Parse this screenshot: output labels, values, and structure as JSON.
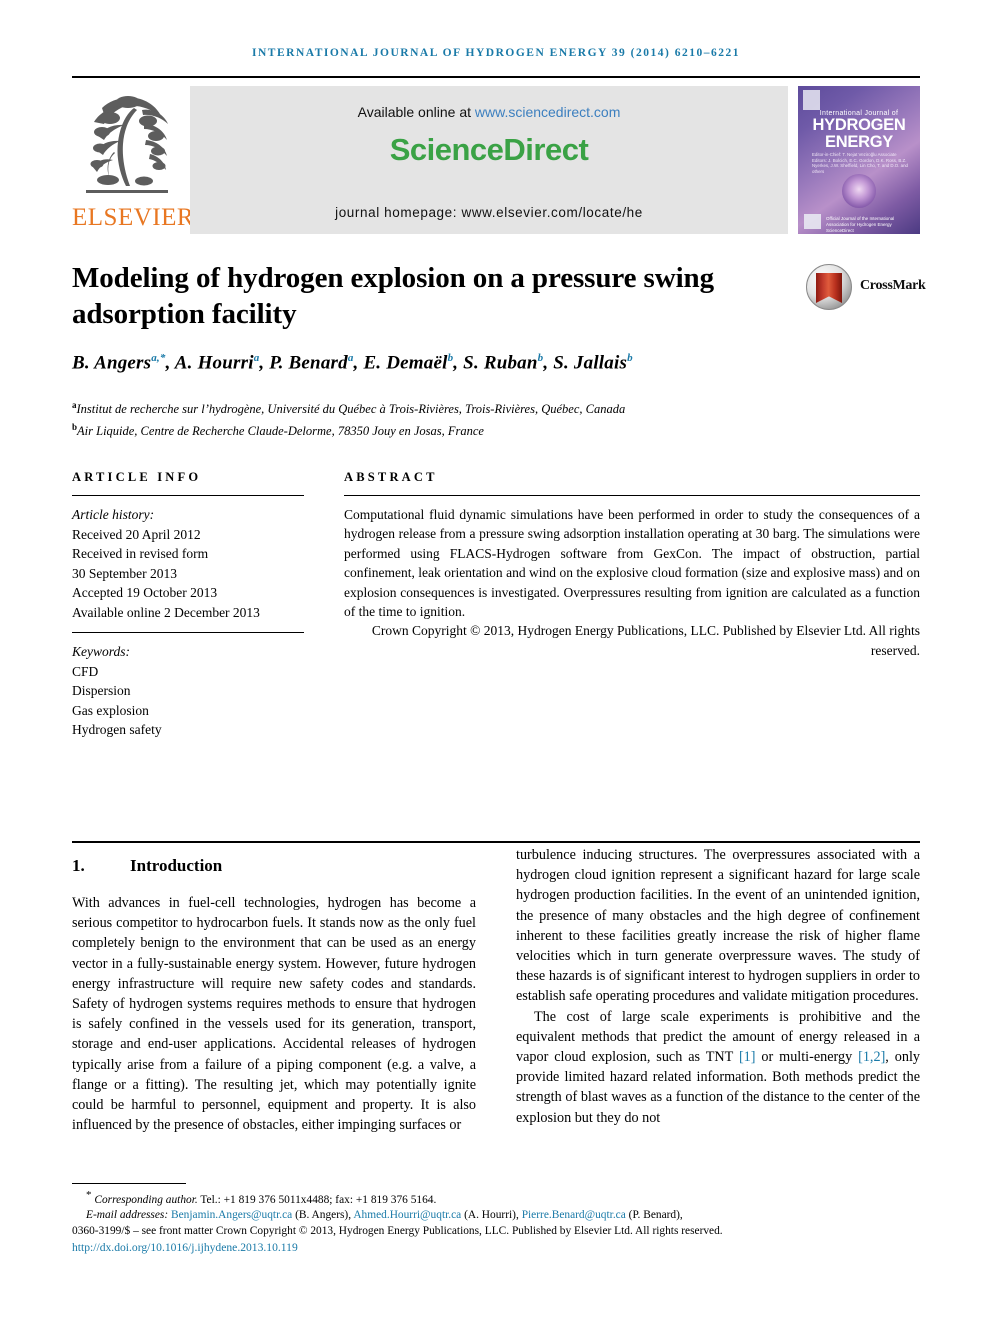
{
  "running_head": "International Journal of Hydrogen Energy 39 (2014) 6210–6221",
  "masthead": {
    "publisher_name": "ELSEVIER",
    "tree_logo_name": "elsevier-tree-logo",
    "available_prefix": "Available online at ",
    "sciencedirect_url": "www.sciencedirect.com",
    "sciencedirect_logo": "ScienceDirect",
    "journal_homepage": "journal homepage: www.elsevier.com/locate/he",
    "cover": {
      "line_small": "International Journal of",
      "line_big_1": "HYDROGEN",
      "line_big_2": "ENERGY",
      "editor_block": "Editor-in-Chief: T. Nejat Veziroğlu    Associate Editors: J. Bolcich, E.C. Gordon, D.K. Ross, B.Z. Nyerkes, J.W. Sheffield, Lin Cho, T. and D.O. and others",
      "footer_text": "Official Journal of the International Association for Hydrogen Energy  ScienceDirect"
    }
  },
  "title": "Modeling of hydrogen explosion on a pressure swing adsorption facility",
  "crossmark": {
    "label": "CrossMark",
    "icon_name": "crossmark-icon"
  },
  "authors": [
    {
      "name": "B. Angers",
      "sup": "a,*"
    },
    {
      "name": "A. Hourri",
      "sup": "a"
    },
    {
      "name": "P. Benard",
      "sup": "a"
    },
    {
      "name": "E. Demaël",
      "sup": "b"
    },
    {
      "name": "S. Ruban",
      "sup": "b"
    },
    {
      "name": "S. Jallais",
      "sup": "b"
    }
  ],
  "affiliations": [
    {
      "marker": "a",
      "text": "Institut de recherche sur l’hydrogène, Université du Québec à Trois-Rivières, Trois-Rivières, Québec, Canada"
    },
    {
      "marker": "b",
      "text": "Air Liquide, Centre de Recherche Claude-Delorme, 78350 Jouy en Josas, France"
    }
  ],
  "article_info": {
    "heading": "Article info",
    "history_label": "Article history:",
    "history": [
      "Received 20 April 2012",
      "Received in revised form",
      "30 September 2013",
      "Accepted 19 October 2013",
      "Available online 2 December 2013"
    ],
    "keywords_label": "Keywords:",
    "keywords": [
      "CFD",
      "Dispersion",
      "Gas explosion",
      "Hydrogen safety"
    ]
  },
  "abstract": {
    "heading": "Abstract",
    "text": "Computational fluid dynamic simulations have been performed in order to study the consequences of a hydrogen release from a pressure swing adsorption installation operating at 30 barg. The simulations were performed using FLACS-Hydrogen software from GexCon. The impact of obstruction, partial confinement, leak orientation and wind on the explosive cloud formation (size and explosive mass) and on explosion consequences is investigated. Overpressures resulting from ignition are calculated as a function of the time to ignition.",
    "copyright": "Crown Copyright © 2013, Hydrogen Energy Publications, LLC. Published by Elsevier Ltd. All rights reserved."
  },
  "body": {
    "section_number": "1.",
    "section_title": "Introduction",
    "left_paragraph_1": "With advances in fuel-cell technologies, hydrogen has become a serious competitor to hydrocarbon fuels. It stands now as the only fuel completely benign to the environment that can be used as an energy vector in a fully-sustainable energy system. However, future hydrogen energy infrastructure will require new safety codes and standards. Safety of hydrogen systems requires methods to ensure that hydrogen is safely confined in the vessels used for its generation, transport, storage and end-user applications. Accidental releases of hydrogen typically arise from a failure of a piping component (e.g. a valve, a flange or a fitting). The resulting jet, which may potentially ignite could be harmful to personnel, equipment and property. It is also influenced by the presence of obstacles, either impinging surfaces or",
    "right_paragraph_1": "turbulence inducing structures. The overpressures associated with a hydrogen cloud ignition represent a significant hazard for large scale hydrogen production facilities. In the event of an unintended ignition, the presence of many obstacles and the high degree of confinement inherent to these facilities greatly increase the risk of higher flame velocities which in turn generate overpressure waves. The study of these hazards is of significant interest to hydrogen suppliers in order to establish safe operating procedures and validate mitigation procedures.",
    "right_paragraph_2_a": "The cost of large scale experiments is prohibitive and the equivalent methods that predict the amount of energy released in a vapor cloud explosion, such as TNT ",
    "right_paragraph_2_ref1": "[1]",
    "right_paragraph_2_b": " or multi-energy ",
    "right_paragraph_2_ref2": "[1,2]",
    "right_paragraph_2_c": ", only provide limited hazard related information. Both methods predict the strength of blast waves as a function of the distance to the center of the explosion but they do not"
  },
  "footnote": {
    "corresponding_marker": "*",
    "corresponding_label": "Corresponding author.",
    "corresponding_contact": " Tel.: +1 819 376 5011x4488; fax: +1 819 376 5164.",
    "email_label": "E-mail addresses:",
    "emails": [
      {
        "address": "Benjamin.Angers@uqtr.ca",
        "person": "(B. Angers)"
      },
      {
        "address": "Ahmed.Hourri@uqtr.ca",
        "person": "(A. Hourri)"
      },
      {
        "address": "Pierre.Benard@uqtr.ca",
        "person": "(P. Benard)"
      }
    ],
    "issn_line": "0360-3199/$ – see front matter Crown Copyright © 2013, Hydrogen Energy Publications, LLC. Published by Elsevier Ltd. All rights reserved.",
    "doi": "http://dx.doi.org/10.1016/j.ijhydene.2013.10.119"
  },
  "colors": {
    "journal_blue": "#1a7aa8",
    "elsevier_orange": "#e87722",
    "sciencedirect_green": "#3aa245",
    "link_blue": "#3c7fbf"
  }
}
